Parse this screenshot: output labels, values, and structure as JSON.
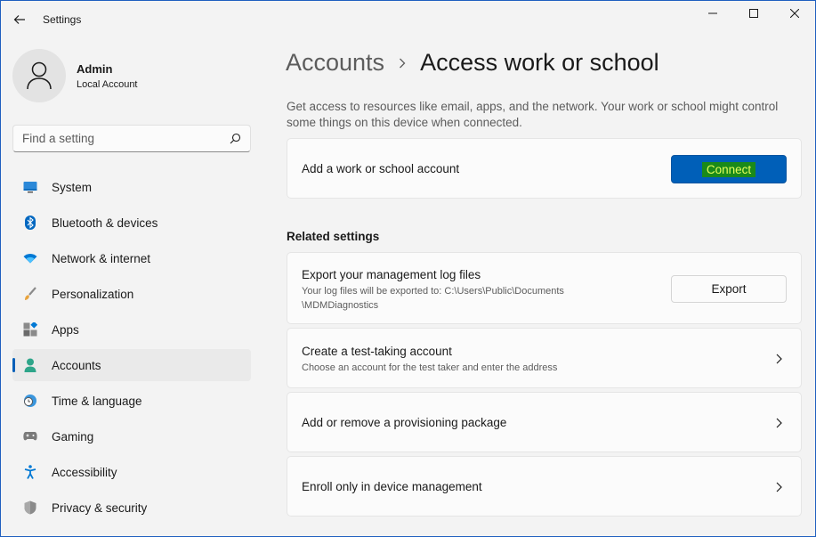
{
  "window": {
    "title": "Settings"
  },
  "profile": {
    "name": "Admin",
    "account_type": "Local Account"
  },
  "search": {
    "placeholder": "Find a setting"
  },
  "sidebar": {
    "items": [
      {
        "label": "System",
        "icon": "system-icon",
        "active": false
      },
      {
        "label": "Bluetooth & devices",
        "icon": "bluetooth-icon",
        "active": false
      },
      {
        "label": "Network & internet",
        "icon": "wifi-icon",
        "active": false
      },
      {
        "label": "Personalization",
        "icon": "brush-icon",
        "active": false
      },
      {
        "label": "Apps",
        "icon": "apps-icon",
        "active": false
      },
      {
        "label": "Accounts",
        "icon": "person-icon",
        "active": true
      },
      {
        "label": "Time & language",
        "icon": "globe-clock-icon",
        "active": false
      },
      {
        "label": "Gaming",
        "icon": "gamepad-icon",
        "active": false
      },
      {
        "label": "Accessibility",
        "icon": "accessibility-icon",
        "active": false
      },
      {
        "label": "Privacy & security",
        "icon": "shield-icon",
        "active": false
      }
    ]
  },
  "breadcrumb": {
    "parent": "Accounts",
    "current": "Access work or school"
  },
  "main": {
    "description": "Get access to resources like email, apps, and the network. Your work or school might control some things on this device when connected.",
    "add_account": {
      "label": "Add a work or school account",
      "button": "Connect"
    },
    "related_title": "Related settings",
    "export": {
      "title": "Export your management log files",
      "subtitle_line1": "Your log files will be exported to: C:\\Users\\Public\\Documents",
      "subtitle_line2": "\\MDMDiagnostics",
      "button": "Export"
    },
    "test_account": {
      "title": "Create a test-taking account",
      "subtitle": "Choose an account for the test taker and enter the address"
    },
    "provisioning": {
      "title": "Add or remove a provisioning package"
    },
    "enroll": {
      "title": "Enroll only in device management"
    }
  },
  "colors": {
    "accent": "#005fb8",
    "connect_highlight_bg": "#1a8a1a",
    "connect_highlight_text": "#e8ff5a",
    "window_border": "#1f5fbf"
  }
}
